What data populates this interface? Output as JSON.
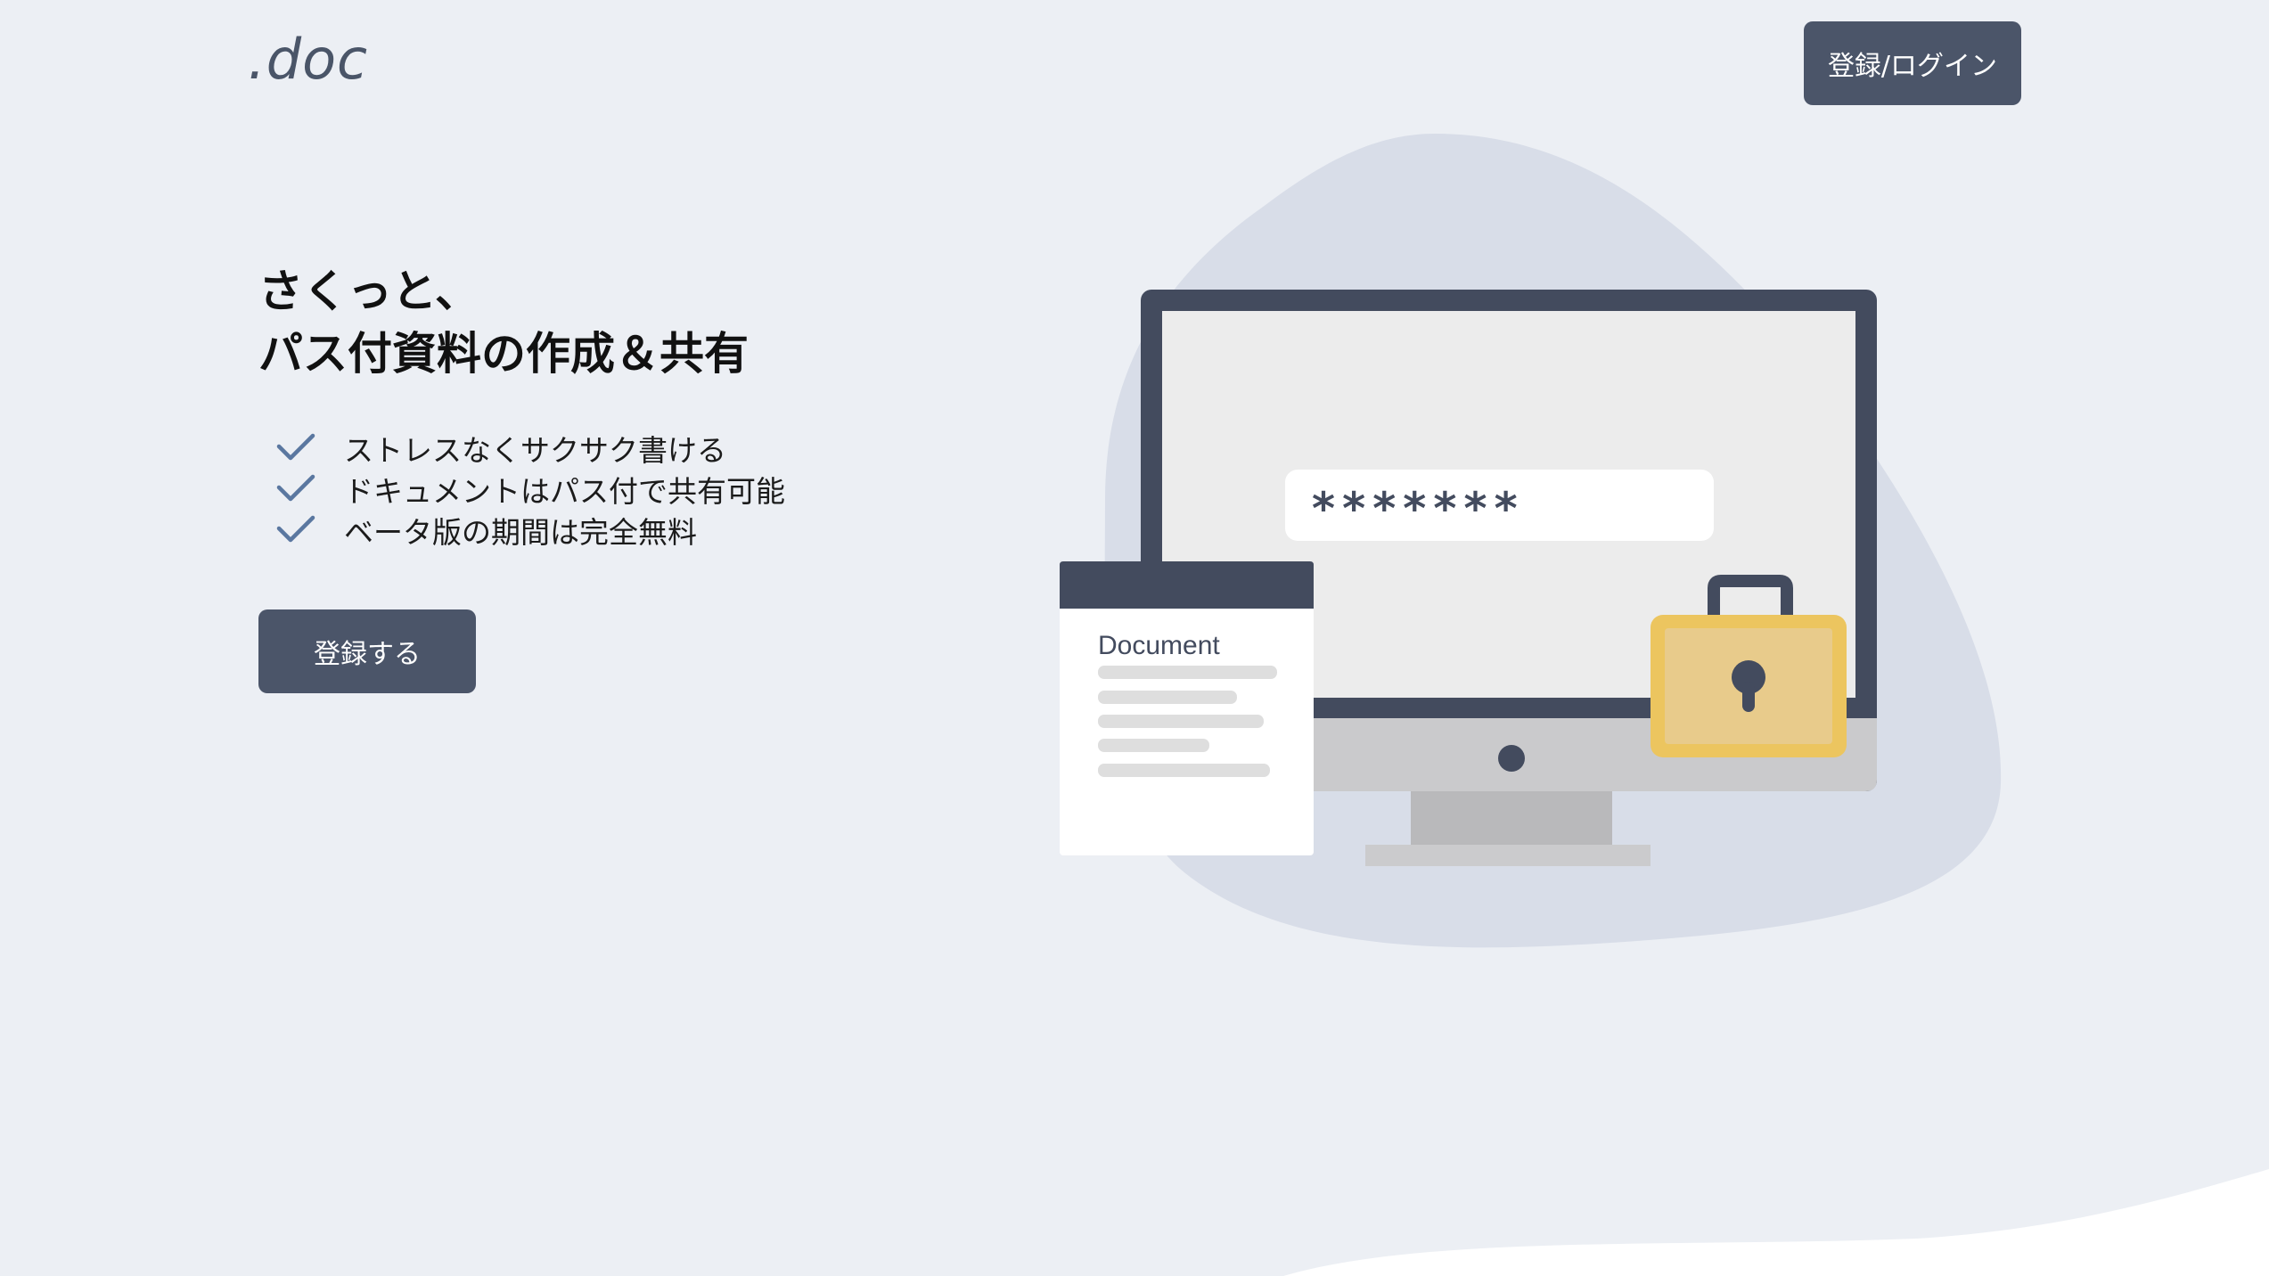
{
  "header": {
    "logo": ".doc",
    "login_button": "登録/ログイン"
  },
  "hero": {
    "headline_line1": "さくっと、",
    "headline_line2": "パス付資料の作成＆共有",
    "features": [
      "ストレスなくサクサク書ける",
      "ドキュメントはパス付で共有可能",
      "ベータ版の期間は完全無料"
    ],
    "register_button": "登録する"
  },
  "illustration": {
    "password_mask": "*******",
    "document_title": "Document"
  },
  "colors": {
    "background": "#eceff4",
    "blob": "#d8dde8",
    "button": "#4b5569",
    "monitor_frame": "#434b5e",
    "check": "#5a77a0",
    "lock": "#ecc55f"
  }
}
